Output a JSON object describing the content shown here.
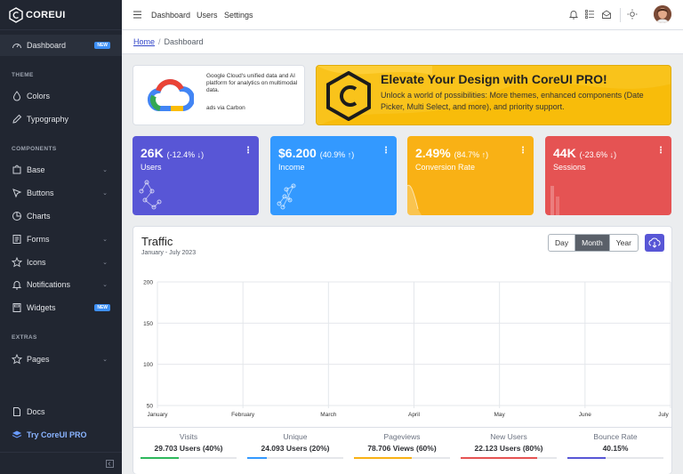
{
  "brand": {
    "name": "COREUI"
  },
  "sidebar": {
    "dashboard": {
      "label": "Dashboard",
      "badge": "NEW"
    },
    "section_theme": "THEME",
    "colors": "Colors",
    "typography": "Typography",
    "section_components": "COMPONENTS",
    "base": "Base",
    "buttons": "Buttons",
    "charts": "Charts",
    "forms": "Forms",
    "icons": "Icons",
    "notifications": "Notifications",
    "widgets": {
      "label": "Widgets",
      "badge": "NEW"
    },
    "section_extras": "EXTRAS",
    "pages": "Pages",
    "docs": "Docs",
    "pro": "Try CoreUI PRO"
  },
  "header": {
    "links": [
      "Dashboard",
      "Users",
      "Settings"
    ]
  },
  "breadcrumb": {
    "home": "Home",
    "separator": "/",
    "current": "Dashboard"
  },
  "ad": {
    "text": "Google Cloud's unified data and AI platform for analytics on multimodal data.",
    "via": "ads via Carbon"
  },
  "promo": {
    "title": "Elevate Your Design with CoreUI PRO!",
    "description": "Unlock a world of possibilities: More themes, enhanced components (Date Picker, Multi Select, and more), and priority support."
  },
  "stats": [
    {
      "value": "26K",
      "change": "(-12.4% ↓)",
      "label": "Users",
      "color": "#5856d6"
    },
    {
      "value": "$6.200",
      "change": "(40.9% ↑)",
      "label": "Income",
      "color": "#3399ff"
    },
    {
      "value": "2.49%",
      "change": "(84.7% ↑)",
      "label": "Conversion Rate",
      "color": "#f9b115"
    },
    {
      "value": "44K",
      "change": "(-23.6% ↓)",
      "label": "Sessions",
      "color": "#e55353"
    }
  ],
  "traffic": {
    "title": "Traffic",
    "subtitle": "January - July 2023",
    "periods": [
      "Day",
      "Month",
      "Year"
    ],
    "selected_period": "Month"
  },
  "chart_data": {
    "type": "line",
    "categories": [
      "January",
      "February",
      "March",
      "April",
      "May",
      "June",
      "July"
    ],
    "y_ticks": [
      "200",
      "150",
      "100",
      "50"
    ],
    "ylim": [
      50,
      200
    ],
    "grid": true,
    "series": []
  },
  "traffic_stats": [
    {
      "title": "Visits",
      "value": "29.703 Users (40%)",
      "percent": 40,
      "color": "#2eb85c"
    },
    {
      "title": "Unique",
      "value": "24.093 Users (20%)",
      "percent": 20,
      "color": "#3399ff"
    },
    {
      "title": "Pageviews",
      "value": "78.706 Views (60%)",
      "percent": 60,
      "color": "#f9b115"
    },
    {
      "title": "New Users",
      "value": "22.123 Users (80%)",
      "percent": 80,
      "color": "#e55353"
    },
    {
      "title": "Bounce Rate",
      "value": "40.15%",
      "percent": 40.15,
      "color": "#5856d6"
    }
  ]
}
